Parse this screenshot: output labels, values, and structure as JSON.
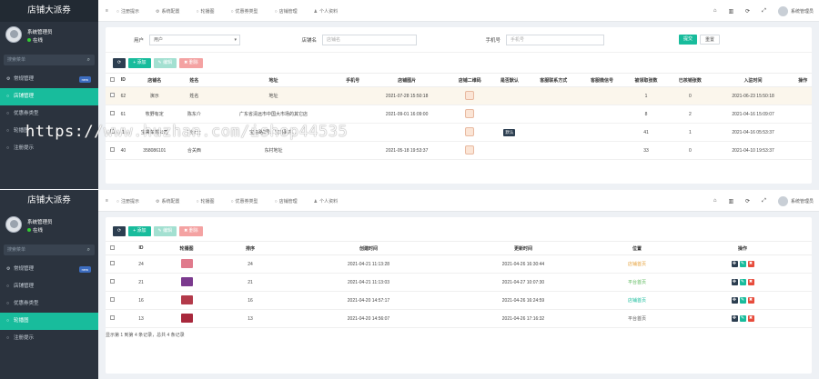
{
  "brand": "店铺大派券",
  "user": {
    "name": "系统管理员",
    "status": "在线"
  },
  "sidebar_search": "搜索菜单",
  "menu": [
    {
      "label": "常规管理",
      "icon": "gear-icon",
      "badge": "new"
    },
    {
      "label": "店铺管理",
      "icon": "circle-icon"
    },
    {
      "label": "优惠券类型",
      "icon": "circle-icon"
    },
    {
      "label": "轮播图",
      "icon": "circle-icon"
    },
    {
      "label": "注册提示",
      "icon": "circle-icon"
    }
  ],
  "tabs": [
    "注册提示",
    "系统配置",
    "轮播图",
    "优惠券类型",
    "店铺管理",
    "个人资料"
  ],
  "tabs2": [
    "注册提示",
    "系统配置",
    "轮播图",
    "优惠券类型",
    "店铺管理",
    "个人资料"
  ],
  "topbar": {
    "admin": "系统管理员"
  },
  "shop_search": {
    "user_label": "用户",
    "user_value": "用户",
    "name_label": "店铺名",
    "name_placeholder": "店铺名",
    "phone_label": "手机号",
    "phone_placeholder": "手机号",
    "submit": "提交",
    "reset": "重置"
  },
  "toolbar": {
    "add": "添加",
    "edit": "编辑",
    "delete": "删除"
  },
  "shop_table": {
    "headers": [
      "ID",
      "店铺名",
      "姓名",
      "地址",
      "手机号",
      "店铺图片",
      "店铺二维码",
      "是否默认",
      "客服联系方式",
      "客服微信号",
      "被领取张数",
      "已核销张数",
      "入驻时间",
      "操作"
    ],
    "rows": [
      {
        "id": "62",
        "name": "演示",
        "person": "姓名",
        "addr": "地址",
        "phone": "",
        "time": "2021-07-28 15:50:18",
        "def": "",
        "recv": "1",
        "used": "0",
        "join": "2021-06-23 15:50:18"
      },
      {
        "id": "61",
        "name": "牧野有定",
        "person": "陈东介",
        "addr": "广东省清远市中国大市场的其它店",
        "phone": "",
        "time": "2021-09-01 16:09:00",
        "def": "",
        "recv": "8",
        "used": "2",
        "join": "2021-04-16 15:09:07"
      },
      {
        "id": "1",
        "name": "宝来车驾公司",
        "person": "刘女士",
        "addr": "宝马路3号…宝马路东…",
        "phone": "",
        "time": "",
        "def": "默认",
        "recv": "41",
        "used": "1",
        "join": "2021-04-16 05:53:37"
      },
      {
        "id": "40",
        "name": "358086101",
        "person": "合关西",
        "addr": "东村地址",
        "phone": "",
        "time": "2021-05-18 19:53:37",
        "def": "",
        "recv": "33",
        "used": "0",
        "join": "2021-04-10 19:53:37"
      }
    ]
  },
  "banner_table": {
    "headers": [
      "ID",
      "轮播图",
      "排序",
      "创建时间",
      "更新时间",
      "位置",
      "操作"
    ],
    "rows": [
      {
        "id": "24",
        "sort": "24",
        "created": "2021-04-21 11:13:28",
        "updated": "2021-04-26 16:30:44",
        "pos": "店铺首页",
        "pos_color": "#e6a23c",
        "thumb": "#e07a8c"
      },
      {
        "id": "21",
        "sort": "21",
        "created": "2021-04-21 11:13:03",
        "updated": "2021-04-27 10:07:30",
        "pos": "平台首页",
        "pos_color": "#5bb85b",
        "thumb": "#7b3a8e"
      },
      {
        "id": "16",
        "sort": "16",
        "created": "2021-04-20 14:57:17",
        "updated": "2021-04-26 16:24:59",
        "pos": "店铺首页",
        "pos_color": "#18bc9c",
        "thumb": "#b33a4a"
      },
      {
        "id": "13",
        "sort": "13",
        "created": "2021-04-20 14:56:07",
        "updated": "2021-04-26 17:16:32",
        "pos": "平台首页",
        "pos_color": "#555555",
        "thumb": "#a8283c"
      }
    ]
  },
  "pager": "显示第 1 到第 4 条记录，总共 4 条记录",
  "watermark": "https://www.huzhan.com/ishop44535"
}
